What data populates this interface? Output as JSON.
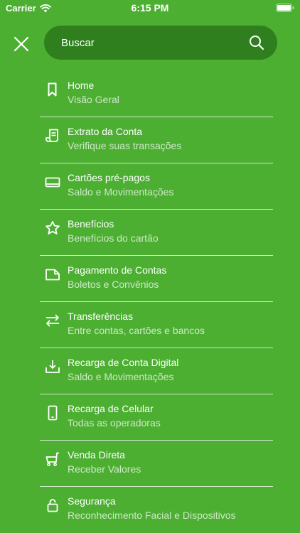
{
  "status_bar": {
    "carrier": "Carrier",
    "time": "6:15 PM"
  },
  "search": {
    "placeholder": "Buscar"
  },
  "menu": {
    "items": [
      {
        "title": "Home",
        "subtitle": "Visão Geral",
        "icon": "bookmark-icon"
      },
      {
        "title": "Extrato da Conta",
        "subtitle": "Verifique suas transações",
        "icon": "receipt-icon"
      },
      {
        "title": "Cartões pré-pagos",
        "subtitle": "Saldo e Movimentações",
        "icon": "card-icon"
      },
      {
        "title": "Benefícios",
        "subtitle": "Benefícios do cartão",
        "icon": "star-icon"
      },
      {
        "title": "Pagamento de Contas",
        "subtitle": "Boletos e Convênios",
        "icon": "document-icon"
      },
      {
        "title": "Transferências",
        "subtitle": "Entre contas, cartões e bancos",
        "icon": "transfer-icon"
      },
      {
        "title": "Recarga de Conta Digital",
        "subtitle": "Saldo e Movimentações",
        "icon": "download-tray-icon"
      },
      {
        "title": "Recarga de Celular",
        "subtitle": "Todas as operadoras",
        "icon": "phone-icon"
      },
      {
        "title": "Venda Direta",
        "subtitle": "Receber Valores",
        "icon": "cart-icon"
      },
      {
        "title": "Segurança",
        "subtitle": "Reconhecimento Facial e Dispositivos",
        "icon": "lock-icon"
      }
    ]
  },
  "colors": {
    "background": "#4caf32",
    "search_bar": "#2f7f1e",
    "text": "#ffffff"
  }
}
